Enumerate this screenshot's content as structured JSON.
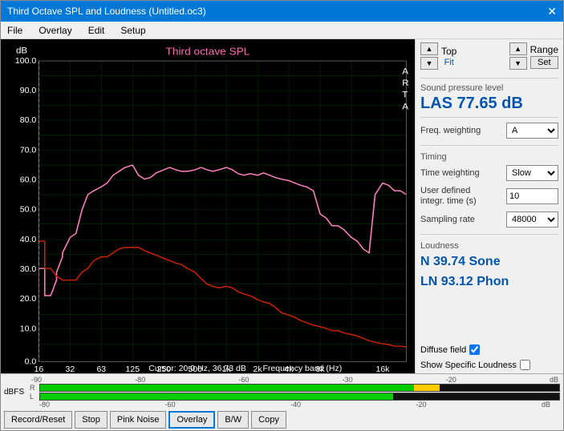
{
  "window": {
    "title": "Third Octave SPL and Loudness (Untitled.oc3)",
    "close_label": "✕"
  },
  "menu": {
    "items": [
      "File",
      "Overlay",
      "Edit",
      "Setup"
    ]
  },
  "chart": {
    "title": "Third octave SPL",
    "y_axis_label": "dB",
    "y_ticks": [
      "100.0",
      "90.0",
      "80.0",
      "70.0",
      "60.0",
      "50.0",
      "40.0",
      "30.0",
      "20.0",
      "10.0",
      "0.0"
    ],
    "x_ticks": [
      "16",
      "32",
      "63",
      "125",
      "250",
      "500",
      "1k",
      "2k",
      "4k",
      "8k",
      "16k"
    ],
    "cursor_info": "Cursor:  20.0 Hz, 36.73 dB",
    "freq_label": "Frequency band (Hz)",
    "arta_lines": [
      "A",
      "R",
      "T",
      "A"
    ]
  },
  "right_panel": {
    "top_btn": "▲",
    "bot_btn": "▼",
    "top_label": "Top",
    "fit_label": "Fit",
    "range_label": "Range",
    "set_label": "Set",
    "spl_section_label": "Sound pressure level",
    "spl_value": "LAS 77.65 dB",
    "freq_weighting_label": "Freq. weighting",
    "freq_weighting_value": "A",
    "timing_label": "Timing",
    "time_weighting_label": "Time weighting",
    "time_weighting_value": "Slow",
    "user_integ_label": "User defined\nintegr. time (s)",
    "user_integ_value": "10",
    "sampling_rate_label": "Sampling rate",
    "sampling_rate_value": "48000",
    "loudness_label": "Loudness",
    "loudness_n": "N 39.74 Sone",
    "loudness_ln": "LN 93.12 Phon",
    "diffuse_field_label": "Diffuse field",
    "show_specific_label": "Show Specific Loudness"
  },
  "bottom": {
    "dbfs_label": "dBFS",
    "r_label": "R",
    "l_label": "L",
    "meter_ticks": [
      "-90",
      "-80",
      "-60",
      "-30",
      "-20",
      "dB"
    ],
    "meter_ticks2": [
      "-80",
      "-60",
      "-40",
      "-20",
      "dB"
    ],
    "buttons": [
      "Record/Reset",
      "Stop",
      "Pink Noise",
      "Overlay",
      "B/W",
      "Copy"
    ]
  },
  "colors": {
    "accent": "#0078d7",
    "chart_bg": "#000000",
    "grid_color": "#004400",
    "grid_bright": "#006600",
    "title_bg": "#0078d7",
    "pink_trace": "#ff69b4",
    "red_trace": "#cc0000",
    "spl_color": "#0055aa"
  }
}
